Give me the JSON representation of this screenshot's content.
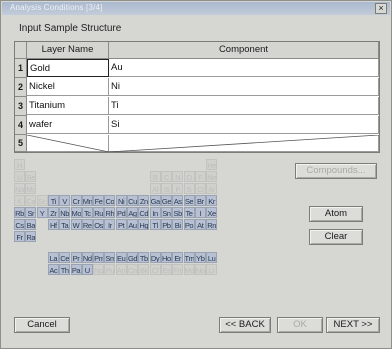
{
  "window": {
    "title": "Analysis Conditions [3/4]",
    "close_glyph": "×"
  },
  "group_label": "Input Sample Structure",
  "table": {
    "headers": {
      "rownum": "",
      "layer": "Layer Name",
      "component": "Component"
    },
    "rows": [
      {
        "num": "1",
        "layer": "Gold",
        "component": "Au"
      },
      {
        "num": "2",
        "layer": "Nickel",
        "component": "Ni"
      },
      {
        "num": "3",
        "layer": "Titanium",
        "component": "Ti"
      },
      {
        "num": "4",
        "layer": "wafer",
        "component": "Si"
      },
      {
        "num": "5",
        "layer": "",
        "component": ""
      }
    ]
  },
  "periodic_table": {
    "main_rows": [
      [
        [
          "H",
          1,
          1,
          "dim"
        ],
        [
          "He",
          18,
          1,
          "dim"
        ]
      ],
      [
        [
          "Li",
          1,
          2,
          "dim"
        ],
        [
          "Be",
          2,
          2,
          "dim"
        ],
        [
          "B",
          13,
          2,
          "dim"
        ],
        [
          "C",
          14,
          2,
          "dim"
        ],
        [
          "N",
          15,
          2,
          "dim"
        ],
        [
          "O",
          16,
          2,
          "dim"
        ],
        [
          "F",
          17,
          2,
          "dim"
        ],
        [
          "Ne",
          18,
          2,
          "dim"
        ]
      ],
      [
        [
          "Na",
          1,
          3,
          "dim"
        ],
        [
          "Mg",
          2,
          3,
          "dim"
        ],
        [
          "Al",
          13,
          3,
          "dim"
        ],
        [
          "Si",
          14,
          3,
          "dim"
        ],
        [
          "P",
          15,
          3,
          "dim"
        ],
        [
          "S",
          16,
          3,
          "dim"
        ],
        [
          "Cl",
          17,
          3,
          "dim"
        ],
        [
          "Ar",
          18,
          3,
          "dim"
        ]
      ],
      [
        [
          "K",
          1,
          4,
          "dim"
        ],
        [
          "Ca",
          2,
          4,
          "dim"
        ],
        [
          "Sc",
          3,
          4,
          "dim"
        ],
        [
          "Ti",
          4,
          4,
          ""
        ],
        [
          "V",
          5,
          4,
          ""
        ],
        [
          "Cr",
          6,
          4,
          ""
        ],
        [
          "Mn",
          7,
          4,
          ""
        ],
        [
          "Fe",
          8,
          4,
          ""
        ],
        [
          "Co",
          9,
          4,
          ""
        ],
        [
          "Ni",
          10,
          4,
          ""
        ],
        [
          "Cu",
          11,
          4,
          ""
        ],
        [
          "Zn",
          12,
          4,
          ""
        ],
        [
          "Ga",
          13,
          4,
          ""
        ],
        [
          "Ge",
          14,
          4,
          ""
        ],
        [
          "As",
          15,
          4,
          ""
        ],
        [
          "Se",
          16,
          4,
          ""
        ],
        [
          "Br",
          17,
          4,
          ""
        ],
        [
          "Kr",
          18,
          4,
          ""
        ]
      ],
      [
        [
          "Rb",
          1,
          5,
          ""
        ],
        [
          "Sr",
          2,
          5,
          ""
        ],
        [
          "Y",
          3,
          5,
          ""
        ],
        [
          "Zr",
          4,
          5,
          ""
        ],
        [
          "Nb",
          5,
          5,
          ""
        ],
        [
          "Mo",
          6,
          5,
          ""
        ],
        [
          "Tc",
          7,
          5,
          ""
        ],
        [
          "Ru",
          8,
          5,
          ""
        ],
        [
          "Rh",
          9,
          5,
          ""
        ],
        [
          "Pd",
          10,
          5,
          ""
        ],
        [
          "Ag",
          11,
          5,
          ""
        ],
        [
          "Cd",
          12,
          5,
          ""
        ],
        [
          "In",
          13,
          5,
          ""
        ],
        [
          "Sn",
          14,
          5,
          ""
        ],
        [
          "Sb",
          15,
          5,
          ""
        ],
        [
          "Te",
          16,
          5,
          ""
        ],
        [
          "I",
          17,
          5,
          ""
        ],
        [
          "Xe",
          18,
          5,
          ""
        ]
      ],
      [
        [
          "Cs",
          1,
          6,
          ""
        ],
        [
          "Ba",
          2,
          6,
          ""
        ],
        [
          "Hf",
          4,
          6,
          ""
        ],
        [
          "Ta",
          5,
          6,
          ""
        ],
        [
          "W",
          6,
          6,
          ""
        ],
        [
          "Re",
          7,
          6,
          ""
        ],
        [
          "Os",
          8,
          6,
          ""
        ],
        [
          "Ir",
          9,
          6,
          ""
        ],
        [
          "Pt",
          10,
          6,
          ""
        ],
        [
          "Au",
          11,
          6,
          ""
        ],
        [
          "Hg",
          12,
          6,
          ""
        ],
        [
          "Tl",
          13,
          6,
          ""
        ],
        [
          "Pb",
          14,
          6,
          ""
        ],
        [
          "Bi",
          15,
          6,
          ""
        ],
        [
          "Po",
          16,
          6,
          ""
        ],
        [
          "At",
          17,
          6,
          ""
        ],
        [
          "Rn",
          18,
          6,
          ""
        ]
      ],
      [
        [
          "Fr",
          1,
          7,
          ""
        ],
        [
          "Ra",
          2,
          7,
          ""
        ]
      ]
    ],
    "lanthanides": [
      [
        "La",
        ""
      ],
      [
        "Ce",
        ""
      ],
      [
        "Pr",
        ""
      ],
      [
        "Nd",
        ""
      ],
      [
        "Pm",
        ""
      ],
      [
        "Sm",
        ""
      ],
      [
        "Eu",
        ""
      ],
      [
        "Gd",
        ""
      ],
      [
        "Tb",
        ""
      ],
      [
        "Dy",
        ""
      ],
      [
        "Ho",
        ""
      ],
      [
        "Er",
        ""
      ],
      [
        "Tm",
        ""
      ],
      [
        "Yb",
        ""
      ],
      [
        "Lu",
        ""
      ]
    ],
    "actinides": [
      [
        "Ac",
        ""
      ],
      [
        "Th",
        ""
      ],
      [
        "Pa",
        ""
      ],
      [
        "U",
        ""
      ],
      [
        "Np",
        "dim"
      ],
      [
        "Pu",
        "dim"
      ],
      [
        "Am",
        "dim"
      ],
      [
        "Cm",
        "dim"
      ],
      [
        "Bk",
        "dim"
      ],
      [
        "Cf",
        "dim"
      ],
      [
        "Es",
        "dim"
      ],
      [
        "Fm",
        "dim"
      ],
      [
        "Md",
        "dim"
      ],
      [
        "No",
        "dim"
      ],
      [
        "Lr",
        "dim"
      ]
    ]
  },
  "buttons": {
    "compound": "Compounds...",
    "atom": "Atom",
    "clear": "Clear",
    "cancel": "Cancel",
    "back": "<< BACK",
    "ok": "OK",
    "next": "NEXT >>"
  }
}
